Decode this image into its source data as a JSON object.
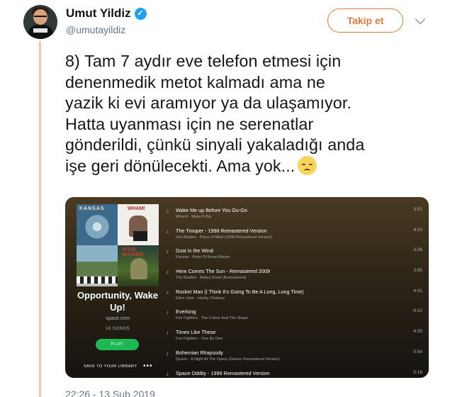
{
  "tweet": {
    "author_name": "Umut Yildiz",
    "verified_mark": "✓",
    "handle": "@umutayildiz",
    "follow_label": "Takip et",
    "text_lines": [
      "8) Tam 7 aydır eve telefon etmesi için",
      "denenmedik metot kalmadı ama ne",
      "yazik ki evi aramıyor ya da ulaşamıyor.",
      "Hatta uyanması için ne serenatlar",
      "gönderildi, çünkü sinyali yakaladığı anda",
      "işe geri dönülecekti. Ama yok..."
    ],
    "emoji": "pensive-face-emoji",
    "timestamp": "22:26 - 13 Şub 2019"
  },
  "playlist": {
    "cover_labels": {
      "kansas": "KANSAS",
      "wham": "WHAM!",
      "iron_maiden": "IRON MAIDEN"
    },
    "title": "Opportunity, Wake Up!",
    "owner": "space.com",
    "song_count": "18 SONGS",
    "play_label": "PLAY",
    "save_label": "SAVE TO YOUR LIBRARY",
    "more_label": "•••",
    "note_glyph": "♪",
    "tracks": [
      {
        "title": "Wake Me up Before You Go-Go",
        "meta": "Wham! · Make It Big",
        "duration": "3:51"
      },
      {
        "title": "The Trooper - 1998 Remastered Version",
        "meta": "Iron Maiden · Piece of Mind (1998 Remastered Version)",
        "duration": "4:10"
      },
      {
        "title": "Dust in the Wind",
        "meta": "Kansas · Point Of Know Return",
        "duration": "3:26"
      },
      {
        "title": "Here Comes The Sun - Remastered 2009",
        "meta": "The Beatles · Abbey Road (Remastered)",
        "duration": "3:05"
      },
      {
        "title": "Rocket Man (I Think It's Going To Be A Long, Long Time)",
        "meta": "Elton John · Honky Chateau",
        "duration": "4:41"
      },
      {
        "title": "Everlong",
        "meta": "Foo Fighters · The Colour And The Shape",
        "duration": "4:10"
      },
      {
        "title": "Times Like These",
        "meta": "Foo Fighters · One By One",
        "duration": "4:25"
      },
      {
        "title": "Bohemian Rhapsody",
        "meta": "Queen · A Night At The Opera (Deluxe Remastered Version)",
        "duration": "5:54"
      },
      {
        "title": "Space Oddity - 1999 Remastered Version",
        "meta": "",
        "duration": "5:16"
      }
    ]
  },
  "colors": {
    "accent": "#e0793f",
    "verified": "#1da1f2",
    "spotify_green": "#1db954",
    "thread_line": "#f3c9a6"
  }
}
